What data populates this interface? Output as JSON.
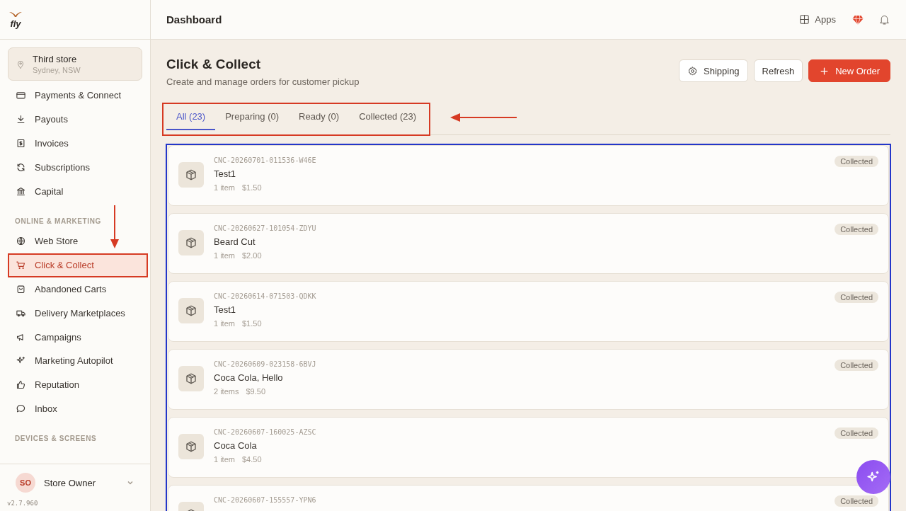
{
  "sidebar": {
    "logo": "fly",
    "store": {
      "name": "Third store",
      "location": "Sydney, NSW"
    },
    "sections": [
      {
        "items": [
          {
            "label": "Payments & Connect",
            "selected": false
          },
          {
            "label": "Payouts",
            "selected": false
          },
          {
            "label": "Invoices",
            "selected": false
          },
          {
            "label": "Subscriptions",
            "selected": false
          },
          {
            "label": "Capital",
            "selected": false
          }
        ]
      },
      {
        "heading": "ONLINE & MARKETING",
        "items": [
          {
            "label": "Web Store",
            "selected": false
          },
          {
            "label": "Click & Collect",
            "selected": true
          },
          {
            "label": "Abandoned Carts",
            "selected": false
          },
          {
            "label": "Delivery Marketplaces",
            "selected": false
          },
          {
            "label": "Campaigns",
            "selected": false
          },
          {
            "label": "Marketing Autopilot",
            "selected": false
          },
          {
            "label": "Reputation",
            "selected": false
          },
          {
            "label": "Inbox",
            "selected": false
          }
        ]
      },
      {
        "heading": "DEVICES & SCREENS"
      }
    ],
    "user": {
      "initials": "SO",
      "name": "Store Owner"
    },
    "version": "v2.7.960"
  },
  "header": {
    "title": "Dashboard",
    "apps": "Apps"
  },
  "page": {
    "title": "Click & Collect",
    "subtitle": "Create and manage orders for customer pickup",
    "buttons": [
      {
        "label": "Shipping",
        "kind": "settings"
      },
      {
        "label": "Refresh",
        "kind": "plain"
      },
      {
        "label": "New Order",
        "kind": "primary"
      }
    ]
  },
  "tabs": [
    {
      "label": "All (23)",
      "selected": true
    },
    {
      "label": "Preparing (0)",
      "selected": false
    },
    {
      "label": "Ready (0)",
      "selected": false
    },
    {
      "label": "Collected (23)",
      "selected": false
    }
  ],
  "orders": [
    {
      "id": "CNC-20260701-011536-W46E",
      "name": "Test1",
      "items": "1 item",
      "total": "$1.50",
      "status": "Collected"
    },
    {
      "id": "CNC-20260627-101054-ZDYU",
      "name": "Beard Cut",
      "items": "1 item",
      "total": "$2.00",
      "status": "Collected"
    },
    {
      "id": "CNC-20260614-071503-QDKK",
      "name": "Test1",
      "items": "1 item",
      "total": "$1.50",
      "status": "Collected"
    },
    {
      "id": "CNC-20260609-023158-6BVJ",
      "name": "Coca Cola, Hello",
      "items": "2 items",
      "total": "$9.50",
      "status": "Collected"
    },
    {
      "id": "CNC-20260607-160025-AZSC",
      "name": "Coca Cola",
      "items": "1 item",
      "total": "$4.50",
      "status": "Collected"
    },
    {
      "id": "CNC-20260607-155557-YPN6",
      "status": "Collected"
    }
  ]
}
